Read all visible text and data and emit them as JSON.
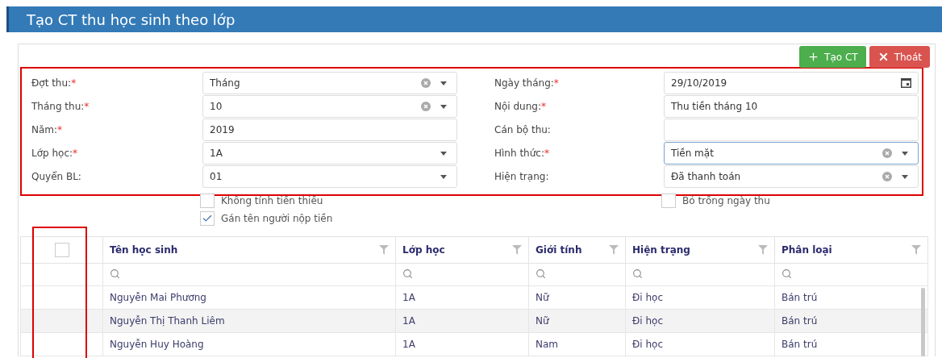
{
  "title": "Tạo CT thu học sinh theo lớp",
  "buttons": [
    {
      "label": "Tạo CT",
      "kind": "create"
    },
    {
      "label": "Thoát",
      "kind": "exit"
    }
  ],
  "form": {
    "left": [
      {
        "label": "Đợt thu:",
        "mark": "*",
        "value": "Tháng",
        "kind": "select",
        "clearable": true,
        "focused": false
      },
      {
        "label": "Tháng thu:",
        "mark": "*",
        "value": "10",
        "kind": "select",
        "clearable": true,
        "focused": false
      },
      {
        "label": "Năm:",
        "mark": "*",
        "value": "2019",
        "kind": "text",
        "focused": false
      },
      {
        "label": "Lớp học:",
        "mark": "*",
        "value": "1A",
        "kind": "select",
        "clearable": false,
        "focused": false
      },
      {
        "label": "Quyển BL:",
        "value": "01",
        "kind": "select",
        "clearable": false,
        "focused": false
      }
    ],
    "right": [
      {
        "label": "Ngày tháng:",
        "mark": "*",
        "value": "29/10/2019",
        "kind": "date",
        "focused": false
      },
      {
        "label": "Nội dung:",
        "mark": "*",
        "value": "Thu tiền tháng 10",
        "kind": "text",
        "focused": false
      },
      {
        "label": "Cán bộ thu:",
        "kind": "text",
        "focused": false
      },
      {
        "label": "Hình thức:",
        "mark": "*",
        "value": "Tiền mặt",
        "kind": "select",
        "clearable": true,
        "focused": true
      },
      {
        "label": "Hiện trạng:",
        "value": "Đã thanh toán",
        "kind": "select",
        "clearable": true,
        "focused": false
      }
    ]
  },
  "left_options": [
    {
      "label": "Không tính tiền thiếu",
      "checked": false
    },
    {
      "label": "Gán tên người nộp tiền",
      "checked": true
    }
  ],
  "right_options": [
    {
      "label": "Bỏ trống ngày thu",
      "checked": false
    }
  ],
  "table": {
    "select_all": {
      "checked": false
    },
    "columns": [
      {
        "label": "Tên học sinh"
      },
      {
        "label": "Lớp học"
      },
      {
        "label": "Giới tính"
      },
      {
        "label": "Hiện trạng"
      },
      {
        "label": "Phân loại"
      }
    ],
    "rows": [
      {
        "cells": [
          "Nguyễn Mai Phương",
          "1A",
          "Nữ",
          "Đi học",
          "Bán trú"
        ]
      },
      {
        "cells": [
          "Nguyễn Thị Thanh Liêm",
          "1A",
          "Nữ",
          "Đi học",
          "Bán trú"
        ]
      },
      {
        "cells": [
          "Nguyễn Huy Hoàng",
          "1A",
          "Nam",
          "Đi học",
          "Bán trú"
        ]
      }
    ]
  }
}
